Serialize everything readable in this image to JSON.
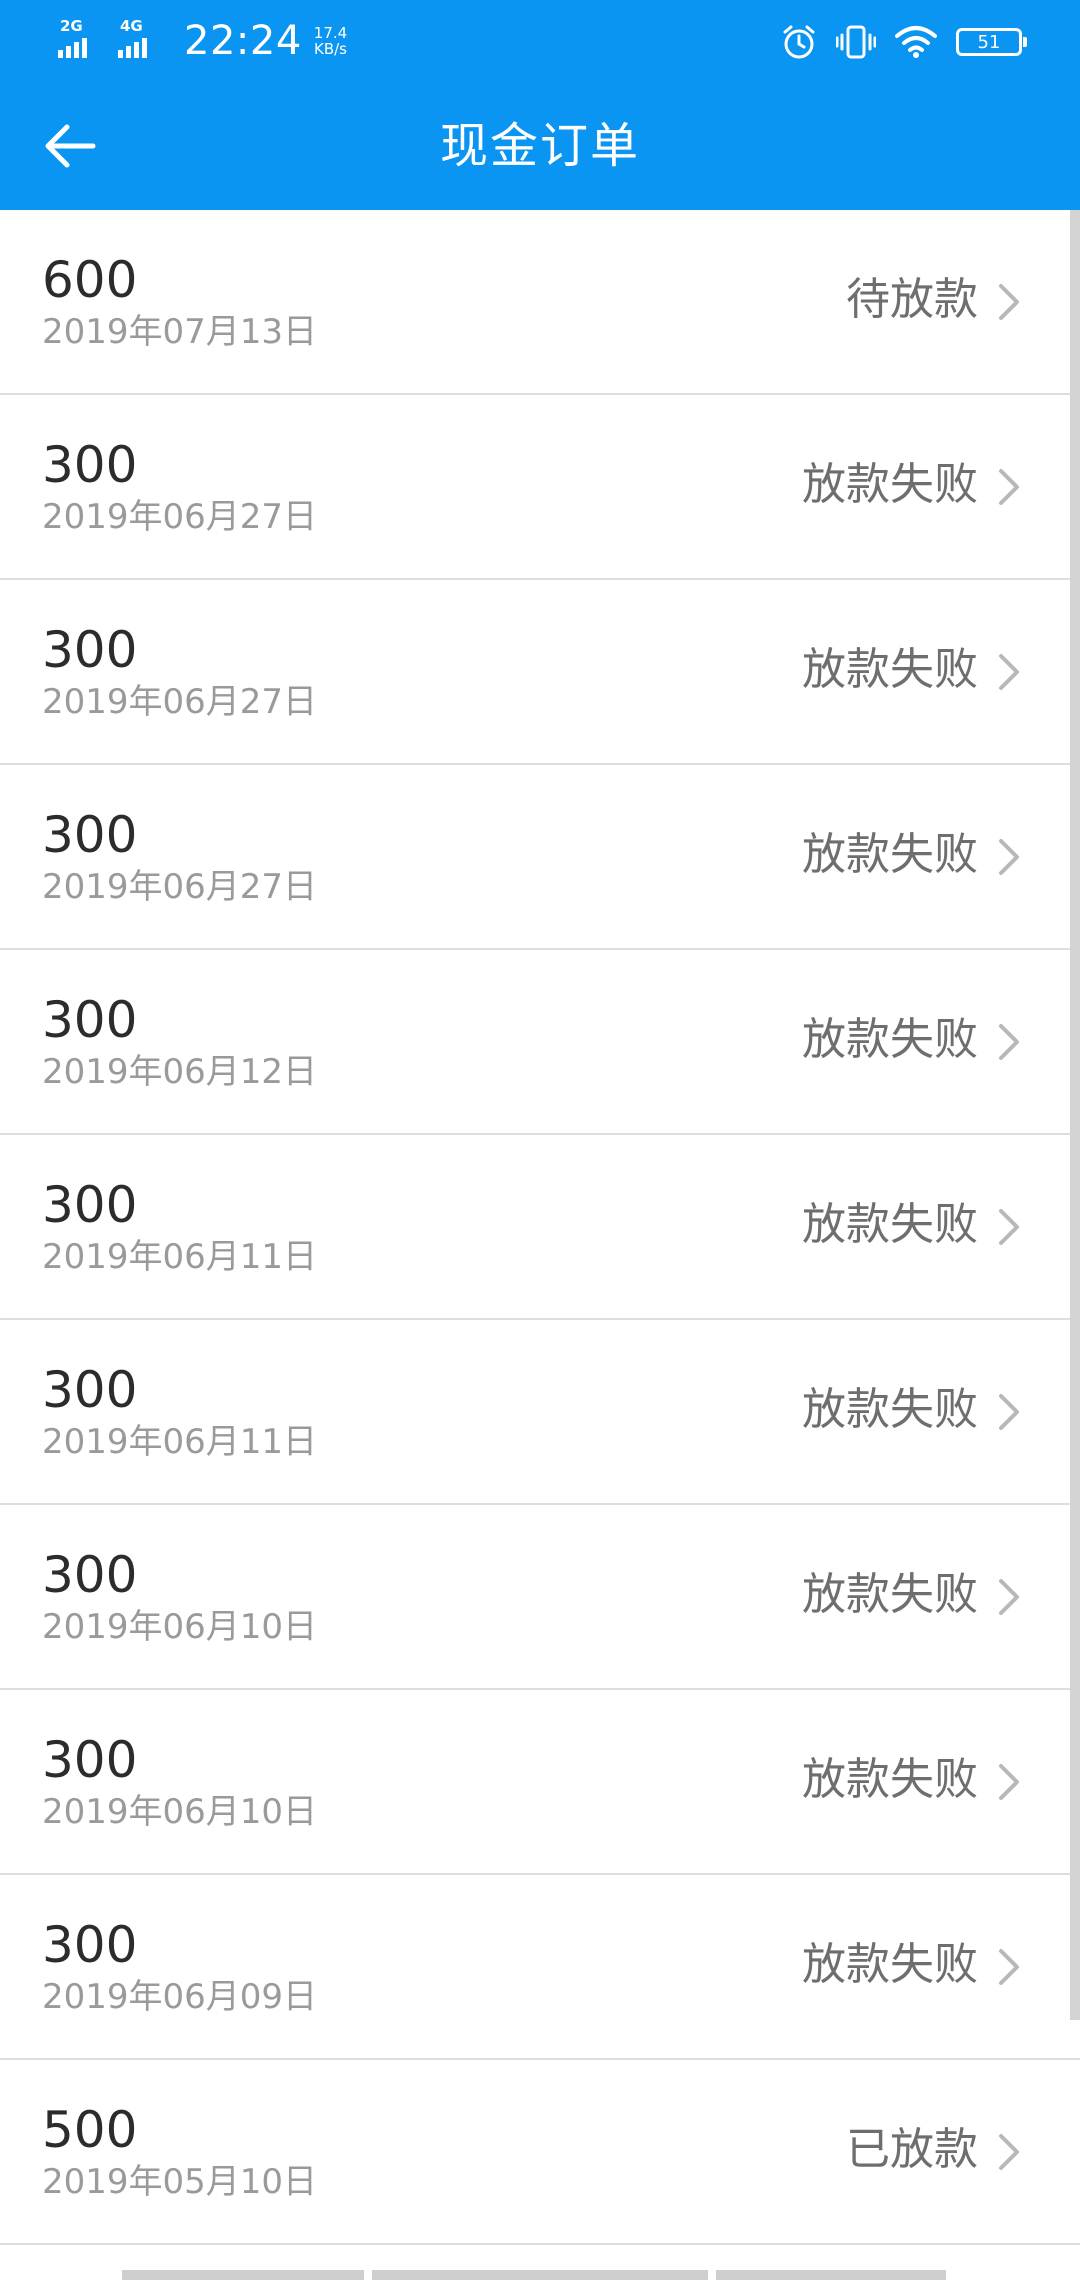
{
  "status_bar": {
    "sim1_network": "2G",
    "sim2_network": "4G",
    "time": "22:24",
    "speed_value": "17.4",
    "speed_unit": "KB/s",
    "battery_level": "51",
    "icons": [
      "alarm-icon",
      "vibrate-icon",
      "wifi-icon",
      "battery-icon"
    ]
  },
  "header": {
    "title": "现金订单",
    "back_icon": "arrow-left-icon"
  },
  "orders": [
    {
      "amount": "600",
      "date": "2019年07月13日",
      "status": "待放款"
    },
    {
      "amount": "300",
      "date": "2019年06月27日",
      "status": "放款失败"
    },
    {
      "amount": "300",
      "date": "2019年06月27日",
      "status": "放款失败"
    },
    {
      "amount": "300",
      "date": "2019年06月27日",
      "status": "放款失败"
    },
    {
      "amount": "300",
      "date": "2019年06月12日",
      "status": "放款失败"
    },
    {
      "amount": "300",
      "date": "2019年06月11日",
      "status": "放款失败"
    },
    {
      "amount": "300",
      "date": "2019年06月11日",
      "status": "放款失败"
    },
    {
      "amount": "300",
      "date": "2019年06月10日",
      "status": "放款失败"
    },
    {
      "amount": "300",
      "date": "2019年06月10日",
      "status": "放款失败"
    },
    {
      "amount": "300",
      "date": "2019年06月09日",
      "status": "放款失败"
    },
    {
      "amount": "500",
      "date": "2019年05月10日",
      "status": "已放款"
    }
  ],
  "colors": {
    "accent": "#0a95f3",
    "amount_text": "#2c2c2c",
    "date_text": "#9a9a9a",
    "status_text": "#6e6e6e",
    "divider": "#dedede"
  }
}
